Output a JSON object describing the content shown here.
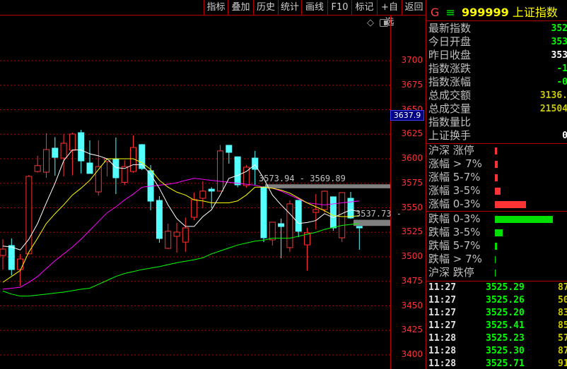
{
  "toolbar": {
    "buttons": [
      "指标",
      "叠加",
      "历史",
      "统计",
      "画线",
      "F10",
      "标记",
      "+自选",
      "返回"
    ]
  },
  "icons": [
    "diamond-icon",
    "panel-toggle-icon"
  ],
  "chart": {
    "y_ticks": [
      3700,
      3675,
      3650,
      3625,
      3600,
      3575,
      3550,
      3525,
      3500,
      3475,
      3450,
      3425,
      3400
    ],
    "current_price_tag": "3637.9",
    "band1_label": "3573.94 - 3569.89",
    "band1": [
      3573.94,
      3569.89
    ],
    "band2_label": "3537.73 -",
    "band2": [
      3537.73,
      3531.5
    ],
    "colors": {
      "up": "#ff3333",
      "down": "#54ffff",
      "ma5": "#ffffff",
      "ma10": "#ffff00",
      "ma20": "#ff00ff",
      "ma60": "#00ff00",
      "grid": "#c00000"
    },
    "candles": [
      [
        3501.4,
        3518,
        3487,
        3507.9
      ],
      [
        3511.5,
        3518.7,
        3481,
        3487
      ],
      [
        3487,
        3503,
        3470,
        3497.8
      ],
      [
        3503,
        3583.5,
        3503,
        3582
      ],
      [
        3587,
        3603,
        3586,
        3593
      ],
      [
        3586.3,
        3626,
        3580.6,
        3609.4
      ],
      [
        3610.8,
        3622,
        3582.7,
        3601.4
      ],
      [
        3600.7,
        3625,
        3582,
        3615.8
      ],
      [
        3608.6,
        3626.6,
        3583,
        3625.2
      ],
      [
        3626.6,
        3629.5,
        3585,
        3597.8
      ],
      [
        3595.7,
        3618.7,
        3585,
        3585
      ],
      [
        3566.2,
        3618.7,
        3562.6,
        3592
      ],
      [
        3597,
        3600,
        3582,
        3600
      ],
      [
        3599.3,
        3621.6,
        3564,
        3580.6
      ],
      [
        3576,
        3598.6,
        3573,
        3592
      ],
      [
        3587,
        3623.7,
        3585.6,
        3611.5
      ],
      [
        3614.4,
        3615,
        3588.5,
        3590
      ],
      [
        3587.8,
        3593.5,
        3547.5,
        3556.8
      ],
      [
        3557.5,
        3561.9,
        3514.4,
        3518.7
      ],
      [
        3508.6,
        3533.8,
        3508,
        3526
      ],
      [
        3520.9,
        3534.5,
        3504.3,
        3525.2
      ],
      [
        3515,
        3540,
        3505,
        3529.5
      ],
      [
        3540.3,
        3565.5,
        3537.4,
        3558.3
      ],
      [
        3559.7,
        3577,
        3550,
        3567
      ],
      [
        3569,
        3571,
        3549.6,
        3567
      ],
      [
        3567,
        3614,
        3567,
        3608
      ],
      [
        3613.7,
        3614,
        3595,
        3606.5
      ],
      [
        3602,
        3602,
        3571,
        3573.4
      ],
      [
        3572.7,
        3593.5,
        3570.5,
        3591.4
      ],
      [
        3600.7,
        3608,
        3573.4,
        3589.2
      ],
      [
        3571.2,
        3572,
        3515,
        3519.4
      ],
      [
        3517.3,
        3535.3,
        3511.5,
        3535.3
      ],
      [
        3533.8,
        3539,
        3498.6,
        3530.9
      ],
      [
        3509.4,
        3557.5,
        3505,
        3554
      ],
      [
        3557.6,
        3557.6,
        3520,
        3526
      ],
      [
        3512.2,
        3529.5,
        3486,
        3524.5
      ],
      [
        3545.3,
        3564,
        3528,
        3548.2
      ],
      [
        3548.2,
        3567.6,
        3545,
        3566.9
      ],
      [
        3561.2,
        3561.2,
        3526.6,
        3529.5
      ],
      [
        3519.4,
        3565.5,
        3515,
        3565.5
      ],
      [
        3559.7,
        3566.2,
        3538.8,
        3539.6
      ],
      [
        3531,
        3531,
        3507.2,
        3529.5
      ]
    ],
    "ma5": [
      3511,
      3510,
      3507,
      3518,
      3534,
      3555,
      3575,
      3598,
      3609,
      3609,
      3605,
      3603,
      3600,
      3591,
      3590,
      3594,
      3594,
      3584,
      3570,
      3553,
      3539,
      3531,
      3531,
      3541,
      3548,
      3563,
      3580,
      3583,
      3587,
      3594,
      3580,
      3563,
      3553,
      3544,
      3534,
      3535,
      3537,
      3544,
      3540,
      3544,
      3548,
      3546
    ],
    "ma10": [
      3474,
      3480,
      3486,
      3505,
      3519,
      3534,
      3544,
      3553,
      3563,
      3570,
      3578,
      3589,
      3600,
      3600,
      3600,
      3600,
      3596,
      3589,
      3578,
      3571,
      3566,
      3563,
      3558,
      3557,
      3555,
      3555,
      3555,
      3557,
      3563,
      3571,
      3571,
      3570,
      3568,
      3565,
      3560,
      3555,
      3551,
      3547,
      3542,
      3541,
      3541,
      3542
    ],
    "ma20": [
      3467,
      3468,
      3469,
      3474,
      3480,
      3488,
      3496,
      3503,
      3510,
      3518,
      3527,
      3536,
      3545,
      3551,
      3558,
      3564,
      3571,
      3572,
      3573,
      3574,
      3575.5,
      3578,
      3580,
      3579,
      3578,
      3577,
      3576,
      3575,
      3574,
      3573,
      3571,
      3570,
      3567,
      3563,
      3559,
      3555,
      3554,
      3553,
      3554,
      3555,
      3556,
      3557
    ],
    "ma60": [
      3465,
      3462,
      3460,
      3460,
      3461,
      3462,
      3463,
      3464,
      3465.5,
      3467,
      3468,
      3472,
      3476,
      3480,
      3483,
      3485,
      3487,
      3488.5,
      3490,
      3492,
      3494,
      3495.5,
      3497,
      3499,
      3503,
      3506,
      3509,
      3512,
      3514,
      3516,
      3517,
      3519,
      3519,
      3519,
      3521,
      3523,
      3525,
      3528,
      3530,
      3532,
      3533,
      3534
    ]
  },
  "panel": {
    "g": "G",
    "menu": "≡",
    "code": "999999",
    "name": "上证指数",
    "stats": [
      {
        "label": "最新指数",
        "value": "352",
        "color": "#00ff00"
      },
      {
        "label": "今日开盘",
        "value": "353",
        "color": "#00ff00"
      },
      {
        "label": "昨日收盘",
        "value": "353",
        "color": "#ffffff"
      },
      {
        "label": "指数涨跌",
        "value": "-1",
        "color": "#00ff00"
      },
      {
        "label": "指数涨幅",
        "value": "-0",
        "color": "#00ff00"
      },
      {
        "label": "总成交额",
        "value": "3136.",
        "color": "#c8c800"
      },
      {
        "label": "总成交量",
        "value": "21504",
        "color": "#c8c800"
      },
      {
        "label": "指数量比",
        "value": "",
        "color": "#ffffff"
      },
      {
        "label": "上证换手",
        "value": "0",
        "color": "#ffffff"
      }
    ],
    "up_dist": [
      {
        "label": "沪深 涨停",
        "level": 0.03
      },
      {
        "label": "涨幅 > 7%",
        "level": 0.04
      },
      {
        "label": "涨幅 5-7%",
        "level": 0.04
      },
      {
        "label": "涨幅 3-5%",
        "level": 0.08
      },
      {
        "label": "涨幅 0-3%",
        "level": 0.44
      }
    ],
    "down_dist": [
      {
        "label": "跌幅 0-3%",
        "level": 0.82
      },
      {
        "label": "跌幅 3-5%",
        "level": 0.11
      },
      {
        "label": "跌幅 5-7%",
        "level": 0.03
      },
      {
        "label": "跌幅 > 7%",
        "level": 0.01
      },
      {
        "label": "沪深 跌停",
        "level": 0.01
      }
    ],
    "ticks": [
      {
        "time": "11:27",
        "price": "3525.29",
        "vol": "87"
      },
      {
        "time": "11:27",
        "price": "3525.26",
        "vol": "50"
      },
      {
        "time": "11:27",
        "price": "3525.20",
        "vol": "83"
      },
      {
        "time": "11:27",
        "price": "3525.41",
        "vol": "85"
      },
      {
        "time": "11:28",
        "price": "3525.23",
        "vol": "57"
      },
      {
        "time": "11:28",
        "price": "3525.30",
        "vol": "87"
      },
      {
        "time": "11:28",
        "price": "3525.71",
        "vol": "91"
      }
    ]
  }
}
